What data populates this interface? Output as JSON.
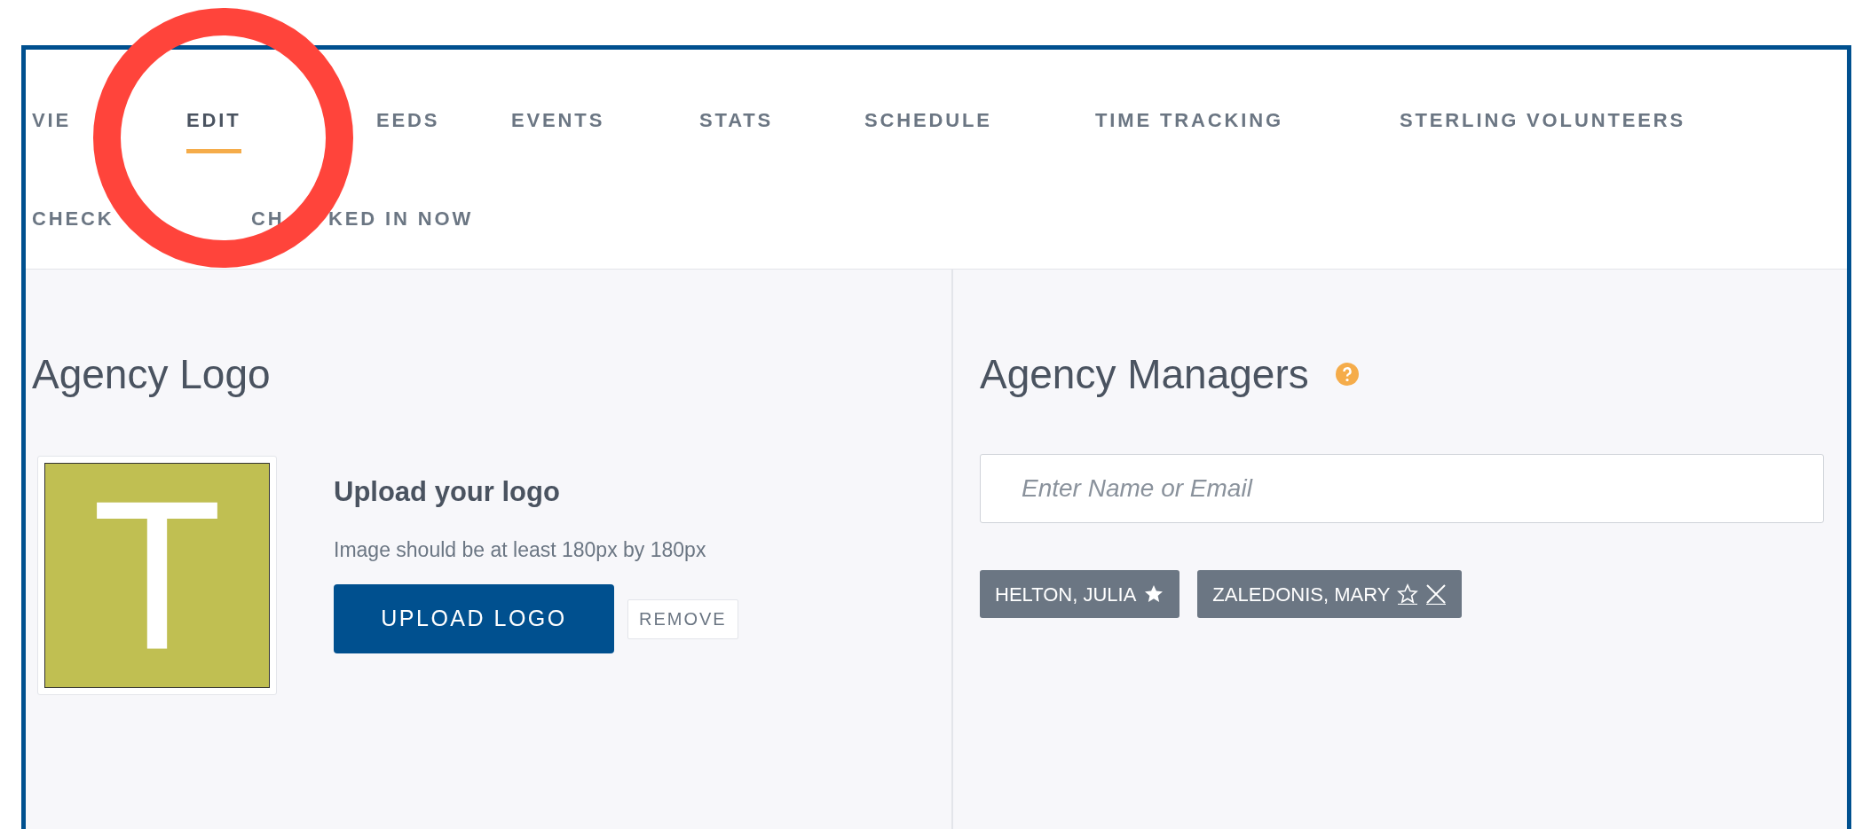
{
  "tabs_row_1": [
    {
      "label": "VIE",
      "selected": false
    },
    {
      "label": "EDIT",
      "selected": true
    },
    {
      "label": "EEDS",
      "selected": false
    },
    {
      "label": "EVENTS",
      "selected": false
    },
    {
      "label": "STATS",
      "selected": false
    },
    {
      "label": "SCHEDULE",
      "selected": false
    },
    {
      "label": "TIME TRACKING",
      "selected": false
    },
    {
      "label": "STERLING VOLUNTEERS",
      "selected": false
    }
  ],
  "tabs_row_2": [
    {
      "label_parts": [
        "CHECK"
      ],
      "selected": false
    },
    {
      "label_parts": [
        "CH",
        "KED IN NOW"
      ],
      "selected": false
    }
  ],
  "logo_section": {
    "title": "Agency Logo",
    "logo_letter": "T",
    "upload_title": "Upload your logo",
    "hint": "Image should be at least 180px by 180px",
    "upload_button": "UPLOAD LOGO",
    "remove_button": "REMOVE"
  },
  "managers_section": {
    "title": "Agency Managers",
    "search": {
      "placeholder": "Enter Name or Email"
    },
    "managers": [
      {
        "name": "HELTON, JULIA",
        "primary": true,
        "removable": false
      },
      {
        "name": "ZALEDONIS, MARY",
        "primary": false,
        "removable": true
      }
    ]
  }
}
